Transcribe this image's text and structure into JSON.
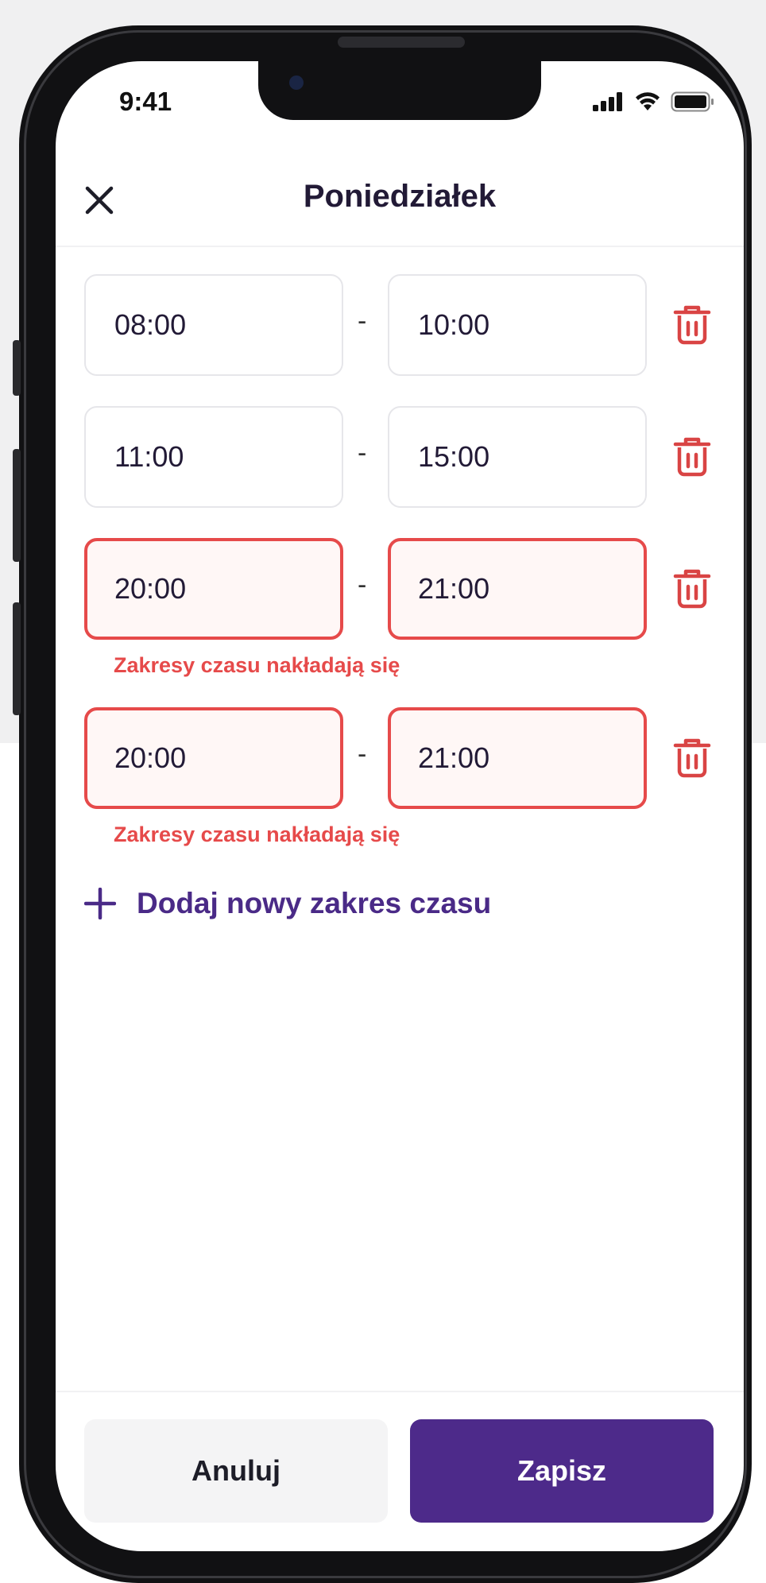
{
  "status_bar": {
    "time": "9:41"
  },
  "header": {
    "title": "Poniedziałek"
  },
  "ranges": [
    {
      "start": "08:00",
      "end": "10:00",
      "separator": "-",
      "error": ""
    },
    {
      "start": "11:00",
      "end": "15:00",
      "separator": "-",
      "error": ""
    },
    {
      "start": "20:00",
      "end": "21:00",
      "separator": "-",
      "error": "Zakresy czasu nakładają się"
    },
    {
      "start": "20:00",
      "end": "21:00",
      "separator": "-",
      "error": "Zakresy czasu nakładają się"
    }
  ],
  "add_range": {
    "label": "Dodaj nowy zakres czasu"
  },
  "footer": {
    "cancel_label": "Anuluj",
    "save_label": "Zapisz"
  },
  "icons": {
    "close": "close-icon",
    "delete": "trash-icon",
    "add": "plus-icon",
    "signal": "cellular-signal-icon",
    "wifi": "wifi-icon",
    "battery": "battery-icon"
  },
  "colors": {
    "primary": "#4d2a8a",
    "error": "#e64a4a",
    "delete_icon": "#d94444",
    "text": "#221a36"
  }
}
